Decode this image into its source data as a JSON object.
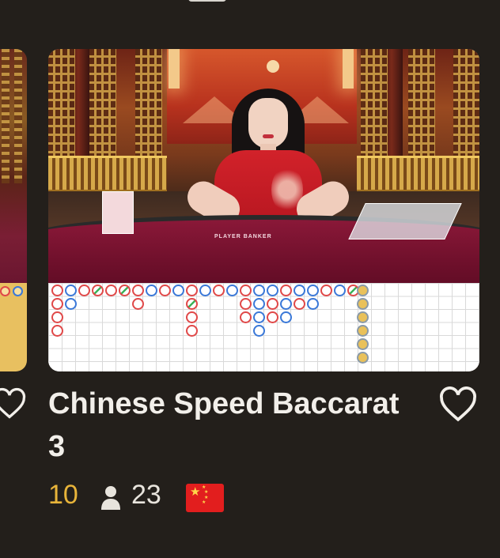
{
  "game": {
    "title": "Chinese Speed Baccarat 3",
    "min_bet": "10",
    "player_count": "23",
    "table_label": "PLAYER BANKER"
  },
  "icons": {
    "favorite": "heart-outline-icon",
    "players": "user-icon",
    "flag": "china-flag-icon"
  },
  "colors": {
    "background": "#231f1b",
    "min_bet": "#e8b43a",
    "title": "#f2efea",
    "banker": "#e04848",
    "player": "#3a78d8",
    "tie": "#3cb35a"
  }
}
